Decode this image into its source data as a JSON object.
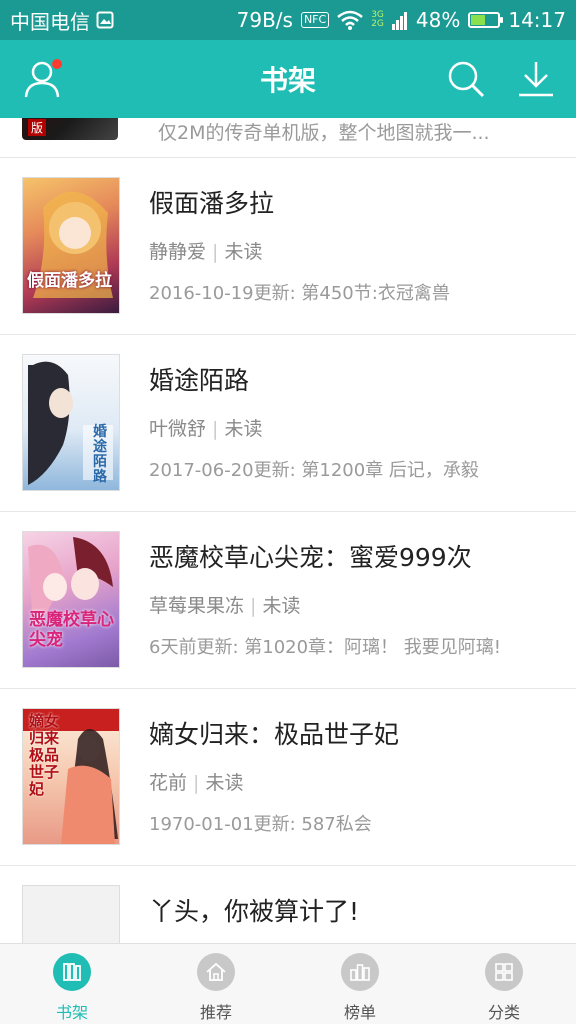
{
  "status_bar": {
    "carrier": "中国电信",
    "net_speed": "79B/s",
    "nfc": "NFC",
    "net_type_top": "3G",
    "net_type_bottom": "2G",
    "battery": "48%",
    "battery_level": 0.48,
    "time": "14:17"
  },
  "header": {
    "title": "书架",
    "accent_color": "#1fbdb4"
  },
  "partial_item": {
    "cover_badge": "版",
    "description": "仅2M的传奇单机版，整个地图就我一..."
  },
  "books": [
    {
      "title": "假面潘多拉",
      "author": "静静爱",
      "status": "未读",
      "update": "2016-10-19更新: 第450节:衣冠禽兽",
      "cover_text": "假面潘多拉"
    },
    {
      "title": "婚途陌路",
      "author": "叶微舒",
      "status": "未读",
      "update": "2017-06-20更新: 第1200章 后记，承毅",
      "cover_text": "婚途陌路"
    },
    {
      "title": "恶魔校草心尖宠：蜜爱999次",
      "author": "草莓果果冻",
      "status": "未读",
      "update": "6天前更新: 第1020章：阿璃！ 我要见阿璃!",
      "cover_text": "恶魔校草心尖宠"
    },
    {
      "title": "嫡女归来：极品世子妃",
      "author": "花前",
      "status": "未读",
      "update": "1970-01-01更新: 587私会",
      "cover_text": "嫡女归来 极品世子妃"
    },
    {
      "title": "丫头，你被算计了!",
      "author": "",
      "status": "",
      "update": "",
      "cover_text": ""
    }
  ],
  "bottom_nav": [
    {
      "label": "书架",
      "icon": "bookshelf-icon",
      "active": true
    },
    {
      "label": "推荐",
      "icon": "home-icon",
      "active": false
    },
    {
      "label": "榜单",
      "icon": "ranking-icon",
      "active": false
    },
    {
      "label": "分类",
      "icon": "category-icon",
      "active": false
    }
  ]
}
